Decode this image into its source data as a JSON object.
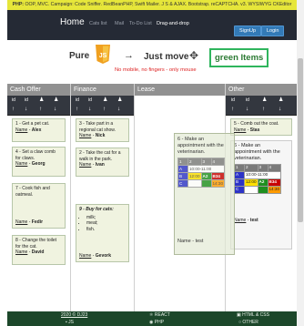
{
  "topbar": {
    "prefix": "PHP:",
    "rest": "OOP, MVC. Campaign: Code Sniffer. RedBeanPHP, Swift Mailer. J S & AJAX. Bootstrap. reCAPTCHA. v3. WYSIWYG CKEditor"
  },
  "nav": {
    "home": "Home",
    "links": [
      "Cats list",
      "Mail",
      "To-Do List",
      "Drag-and-drop"
    ],
    "signup": "SignUp",
    "login": "Login"
  },
  "hero": {
    "pure": "Pure",
    "js_logo_text": "JS",
    "arrow": "→",
    "just_move": "Just move",
    "move_icon": "✥",
    "green_items": "green Items",
    "subtitle": "No mobile, no fingers - only mouse"
  },
  "sort_labels": {
    "id": "id",
    "arrow_up": "↑",
    "arrow_down": "↓",
    "user": "👤"
  },
  "columns": [
    {
      "title": "Cash Offer",
      "cards": [
        {
          "text": "1 - Get a pet cat.",
          "name_label": "Name",
          "name": "Alex"
        },
        {
          "text": "4 - Set a claw comb for claws.",
          "name_label": "Name",
          "name": "Georg"
        },
        {
          "text": "7 - Cook fish and oatmeal.",
          "name_label": "Name",
          "name": "Fedir"
        },
        {
          "text": "8 - Change the toilet for the cat.",
          "name_label": "Name",
          "name": "David"
        }
      ]
    },
    {
      "title": "Finance",
      "cards": [
        {
          "text": "3 - Take part in a regional cat show.",
          "name_label": "Name",
          "name": "Nick"
        },
        {
          "text": "2 - Take the cat for a walk in the park.",
          "name_label": "Name",
          "name": "Ivan"
        },
        {
          "text": "9 - Buy for cats:",
          "list": [
            "milk;",
            "meat;",
            "fish."
          ],
          "name_label": "Name",
          "name": "Gevork"
        }
      ]
    },
    {
      "title": "Lease",
      "cards": []
    },
    {
      "title": "Other",
      "cards": [
        {
          "text": "5 - Comb out the coat.",
          "name_label": "Name",
          "name": "Stas"
        },
        {
          "text": "6 - Make an appointment with the veterinarian.",
          "name_label": "Name",
          "name": "test"
        }
      ]
    }
  ],
  "ghost_card": {
    "text": "6 - Make an appointment with the veterinarian.",
    "name_label": "Name",
    "name": "test"
  },
  "mini_table": {
    "header": [
      "1",
      "2",
      "3",
      "4"
    ],
    "rows": [
      [
        "A",
        "10:00-11:00",
        "",
        ""
      ],
      [
        "B",
        "12:00",
        "A2",
        "B34"
      ],
      [
        "C",
        "",
        "",
        "14:30"
      ]
    ]
  },
  "footer": {
    "copyright": "2020 © DJ23",
    "react": "REACT",
    "html_css": "HTML & CSS",
    "js": "JS",
    "php": "PHP",
    "other": "OTHER"
  },
  "colors": {
    "nav_bg": "#252a35",
    "topbar_bg": "#e6e63a",
    "card_border": "#b7c6a9",
    "accent_green": "#2fb55d",
    "footer_bg": "#1c472a"
  }
}
